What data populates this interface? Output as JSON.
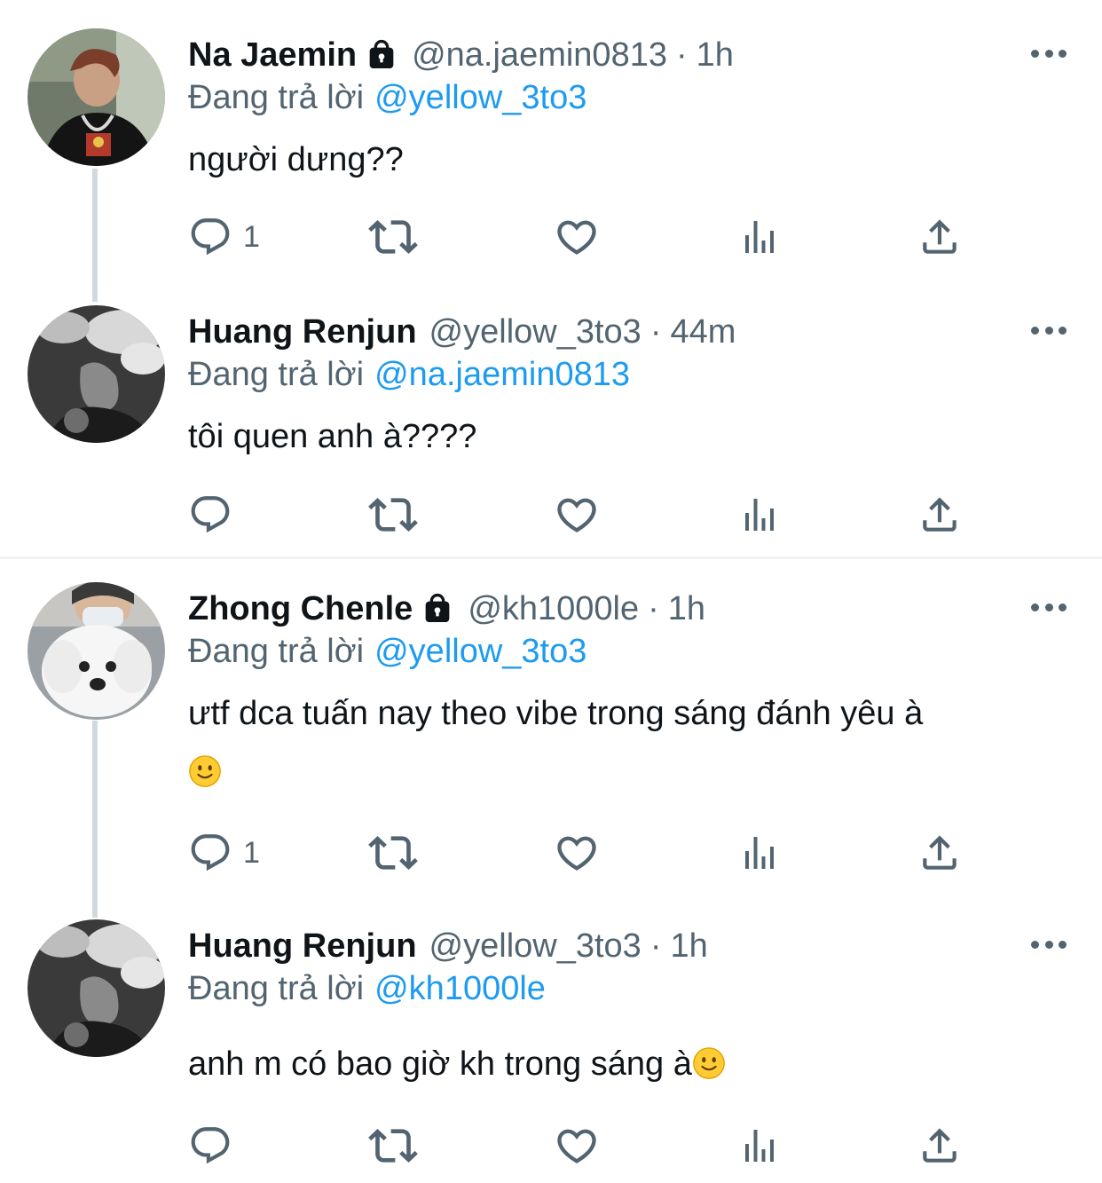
{
  "reply_prefix": "Đang trả lời",
  "tweets": [
    {
      "name": "Na Jaemin",
      "protected": true,
      "handle": "@na.jaemin0813",
      "time": "1h",
      "replying_to": "@yellow_3to3",
      "text": "người dưng??",
      "reply_count": "1",
      "avatar": "avatar-jaemin"
    },
    {
      "name": "Huang Renjun",
      "protected": false,
      "handle": "@yellow_3to3",
      "time": "44m",
      "replying_to": "@na.jaemin0813",
      "text": "tôi quen anh à????",
      "reply_count": "",
      "avatar": "avatar-renjun"
    },
    {
      "name": "Zhong Chenle",
      "protected": true,
      "handle": "@kh1000le",
      "time": "1h",
      "replying_to": "@yellow_3to3",
      "text": "ưtf dca tuấn nay theo vibe trong sáng đánh yêu à",
      "text_emoji": "🙂",
      "reply_count": "1",
      "avatar": "avatar-chenle"
    },
    {
      "name": "Huang Renjun",
      "protected": false,
      "handle": "@yellow_3to3",
      "time": "1h",
      "replying_to": "@kh1000le",
      "text": "anh m có bao giờ kh trong sáng à",
      "text_emoji": "🙂",
      "reply_count": "",
      "avatar": "avatar-renjun"
    }
  ],
  "separator": "·",
  "colors": {
    "text": "#0f1419",
    "secondary": "#536471",
    "link": "#1d9bf0",
    "thread_line": "#cfd9de",
    "divider": "#eff3f4"
  }
}
